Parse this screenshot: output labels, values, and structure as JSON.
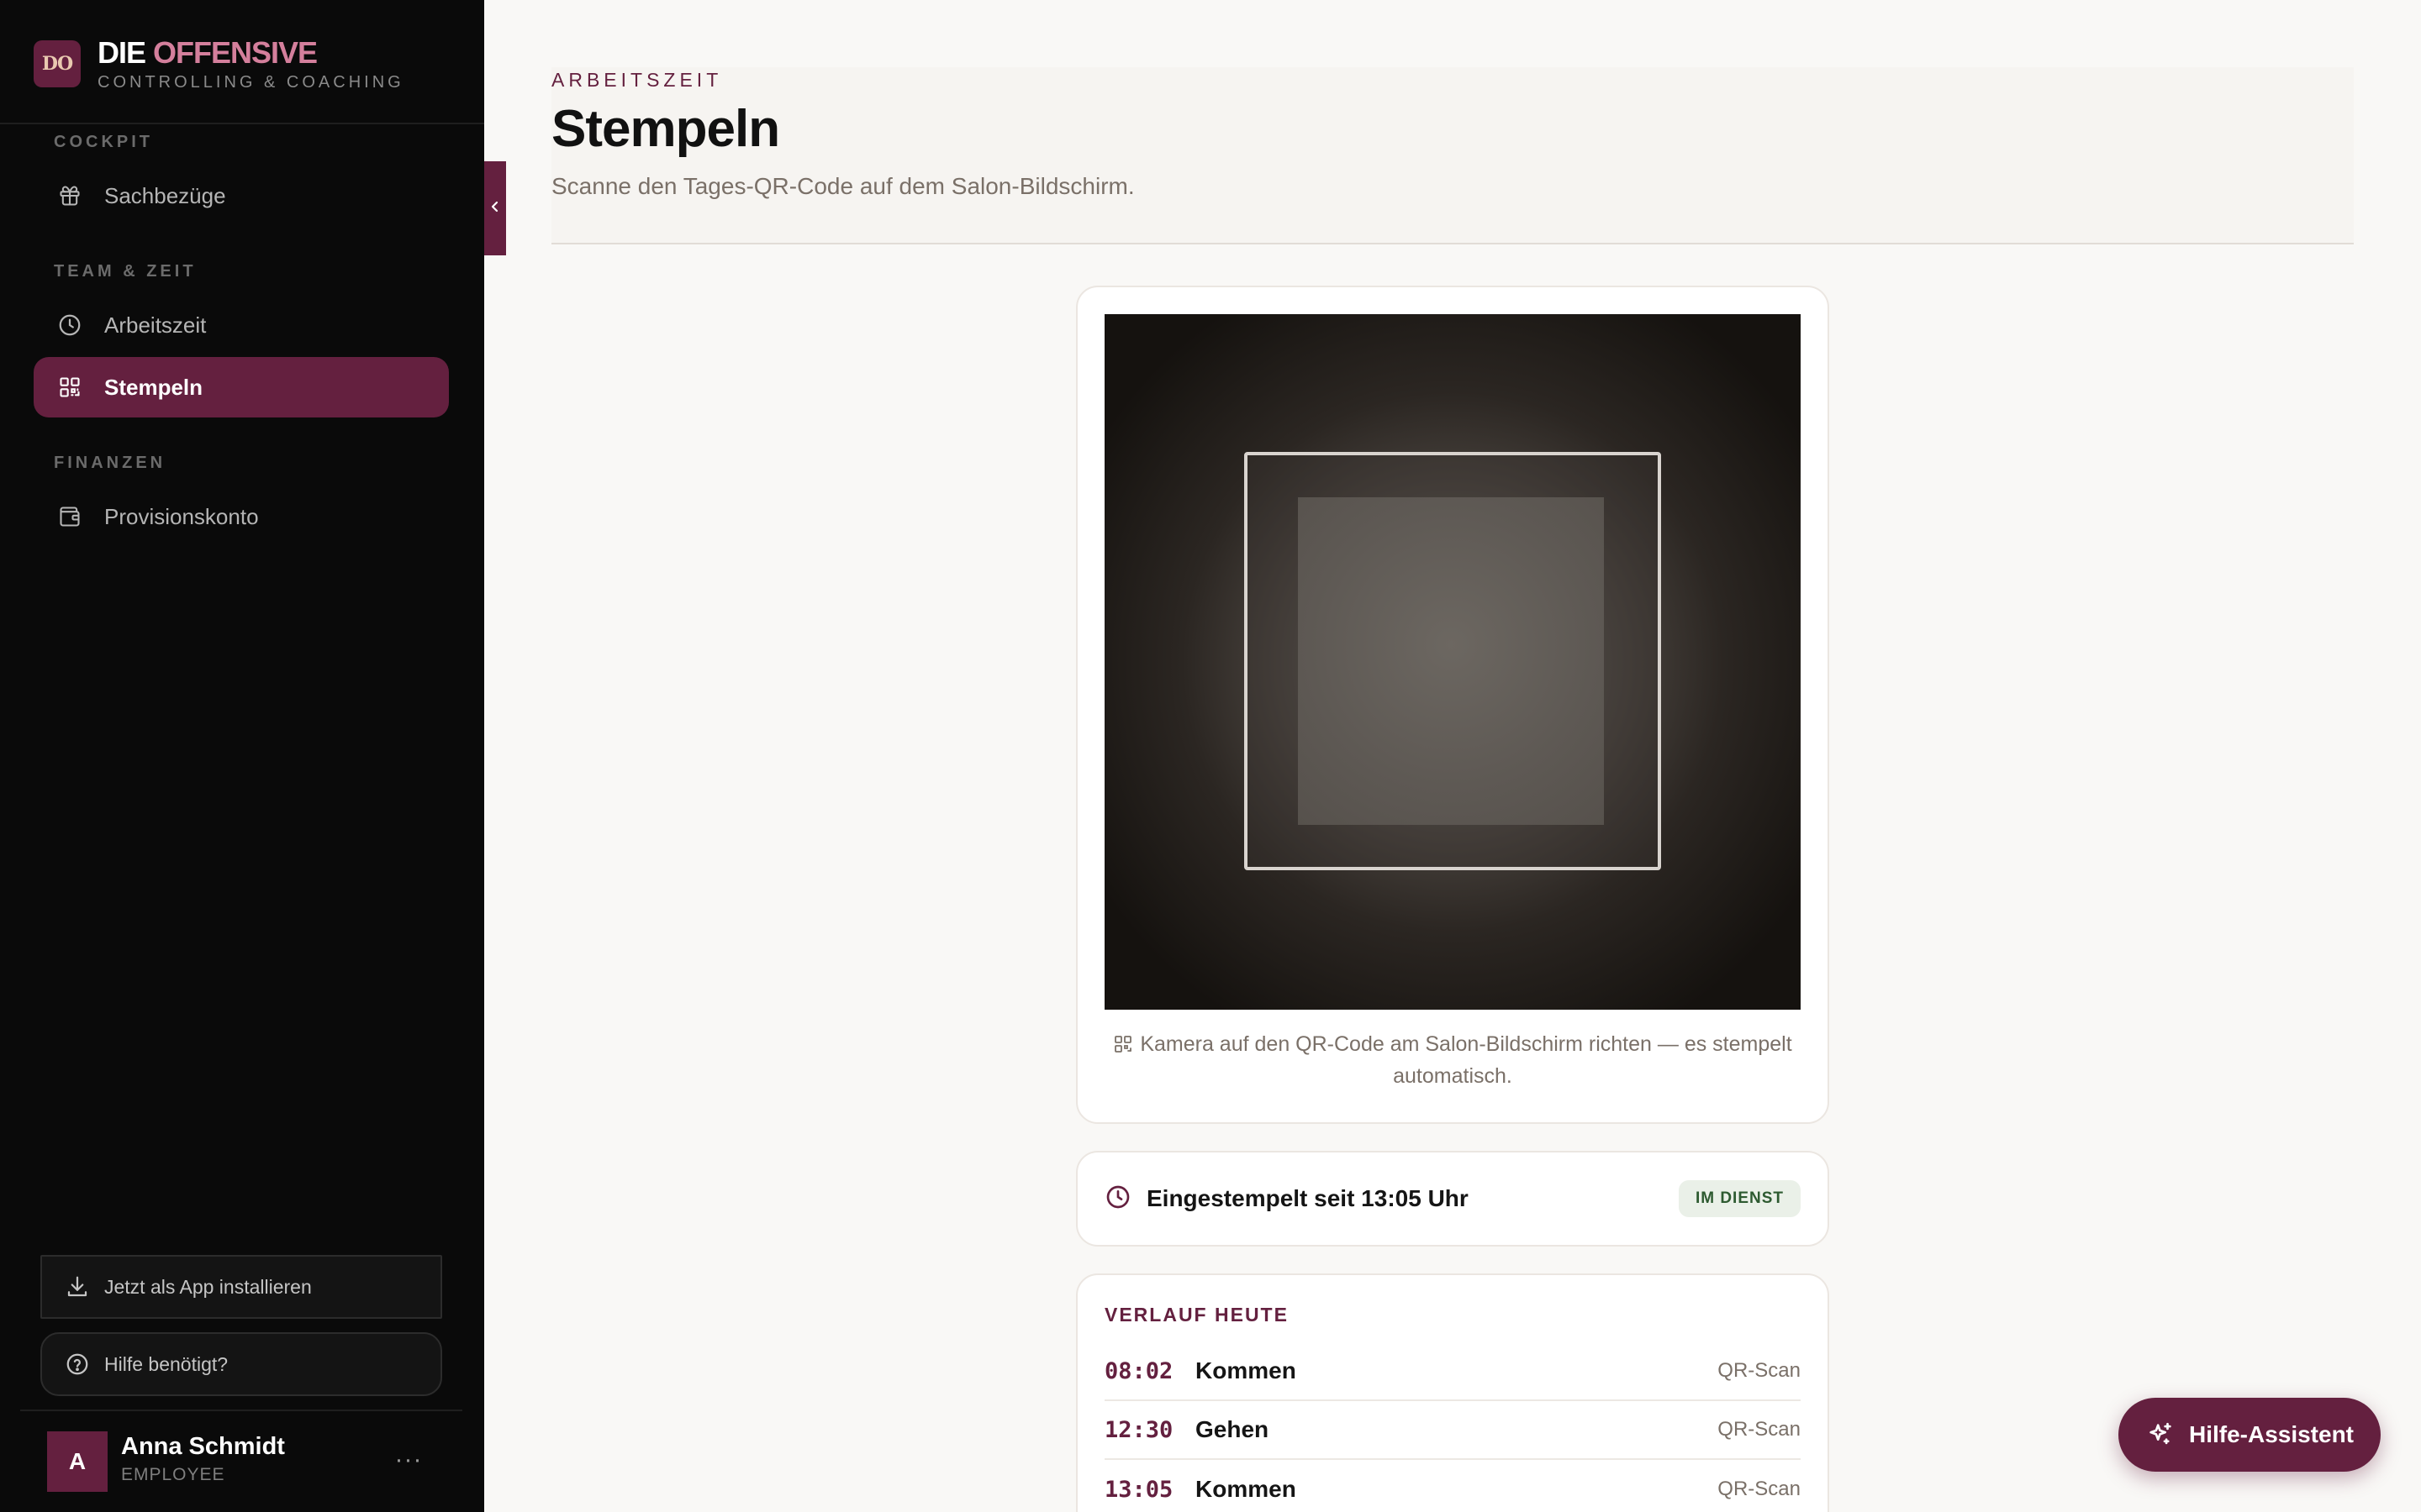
{
  "brand": {
    "logo_initials": "DO",
    "name_part1": "DIE",
    "name_part2": "OFFENSIVE",
    "tagline": "CONTROLLING & COACHING"
  },
  "sidebar": {
    "sections": [
      {
        "title": "COCKPIT",
        "items": [
          {
            "label": "Sachbezüge",
            "icon": "gift-icon",
            "active": false
          }
        ]
      },
      {
        "title": "TEAM & ZEIT",
        "items": [
          {
            "label": "Arbeitszeit",
            "icon": "clock-icon",
            "active": false
          },
          {
            "label": "Stempeln",
            "icon": "qr-code-icon",
            "active": true
          }
        ]
      },
      {
        "title": "FINANZEN",
        "items": [
          {
            "label": "Provisionskonto",
            "icon": "wallet-icon",
            "active": false
          }
        ]
      }
    ],
    "install_label": "Jetzt als App installieren",
    "help_label": "Hilfe benötigt?",
    "user": {
      "initial": "A",
      "name": "Anna Schmidt",
      "role": "EMPLOYEE",
      "more": "···"
    }
  },
  "page": {
    "eyebrow": "ARBEITSZEIT",
    "title": "Stempeln",
    "subtitle": "Scanne den Tages-QR-Code auf dem Salon-Bildschirm."
  },
  "scanner": {
    "hint": "Kamera auf den QR-Code am Salon-Bildschirm richten — es stempelt automatisch."
  },
  "status": {
    "text": "Eingestempelt seit 13:05 Uhr",
    "badge": "IM DIENST"
  },
  "history": {
    "title": "VERLAUF HEUTE",
    "rows": [
      {
        "time": "08:02",
        "type": "Kommen",
        "source": "QR-Scan"
      },
      {
        "time": "12:30",
        "type": "Gehen",
        "source": "QR-Scan"
      },
      {
        "time": "13:05",
        "type": "Kommen",
        "source": "QR-Scan"
      }
    ]
  },
  "assistant": {
    "label": "Hilfe-Assistent"
  },
  "colors": {
    "brand": "#64203f",
    "accent_pink": "#d47f9c",
    "sidebar_bg": "#0a0a0a",
    "badge_green": "#2d5a30"
  }
}
